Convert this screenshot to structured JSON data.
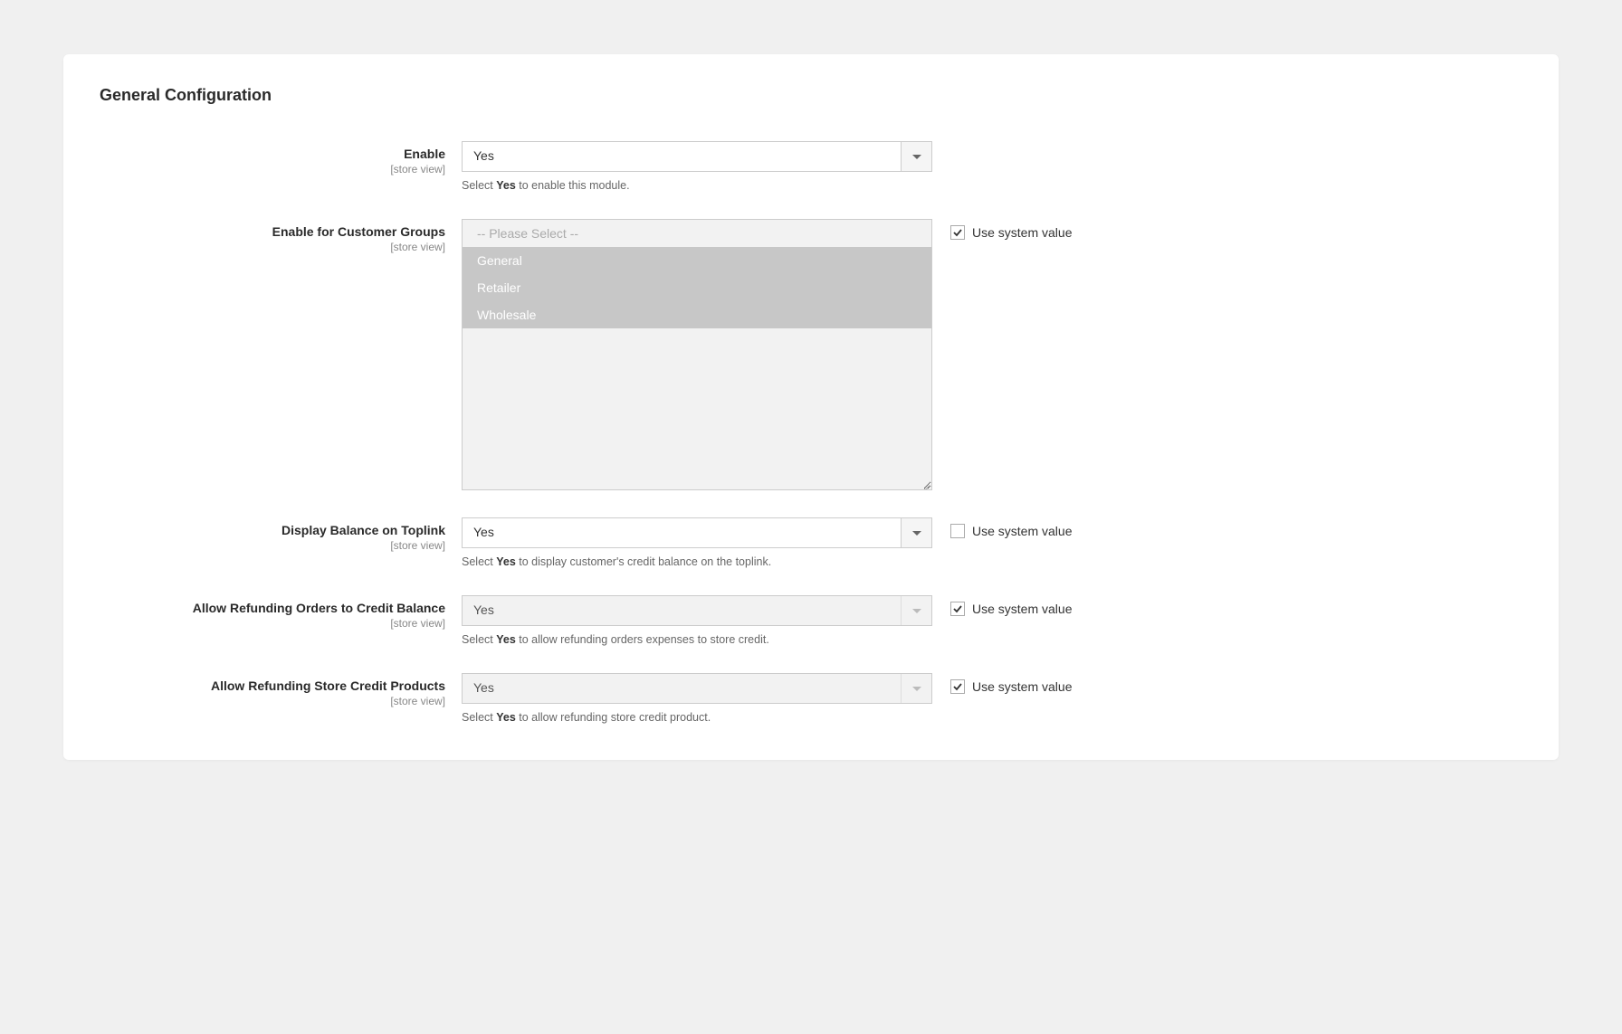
{
  "panel_title": "General Configuration",
  "scope_text": "[store view]",
  "system_value_label": "Use system value",
  "hint_select": "Select ",
  "fields": {
    "enable": {
      "label": "Enable",
      "value": "Yes",
      "hint_after": " to enable this module.",
      "hint_bold": "Yes"
    },
    "customer_groups": {
      "label": "Enable for Customer Groups",
      "options": [
        {
          "label": "-- Please Select --",
          "selected": false
        },
        {
          "label": "General",
          "selected": true
        },
        {
          "label": "Retailer",
          "selected": true
        },
        {
          "label": "Wholesale",
          "selected": true
        }
      ],
      "system_checked": true
    },
    "display_balance": {
      "label": "Display Balance on Toplink",
      "value": "Yes",
      "hint_after": " to display customer's credit balance on the toplink.",
      "hint_bold": "Yes",
      "system_checked": false
    },
    "refund_orders": {
      "label": "Allow Refunding Orders to Credit Balance",
      "value": "Yes",
      "hint_after": " to allow refunding orders expenses to store credit.",
      "hint_bold": "Yes",
      "system_checked": true
    },
    "refund_products": {
      "label": "Allow Refunding Store Credit Products",
      "value": "Yes",
      "hint_after": " to allow refunding store credit product.",
      "hint_bold": "Yes",
      "system_checked": true
    }
  }
}
